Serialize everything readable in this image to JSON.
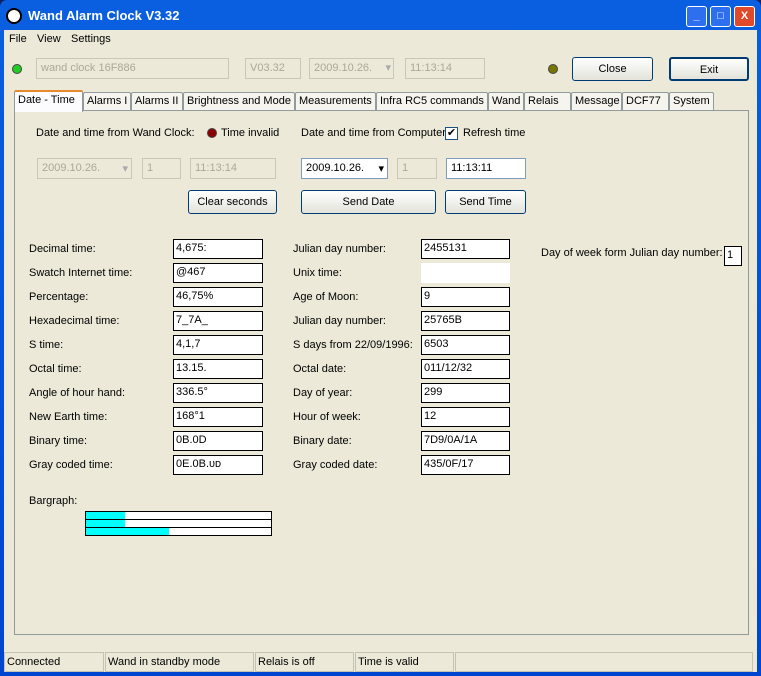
{
  "window": {
    "title": "Wand Alarm Clock V3.32",
    "minimize": "_",
    "maximize": "□",
    "close": "X"
  },
  "menu": [
    "File",
    "View",
    "Settings"
  ],
  "top": {
    "device_name": "wand clock 16F886",
    "version": "V03.32",
    "date": "2009.10.26.",
    "time": "11:13:14",
    "close_label": "Close",
    "exit_label": "Exit",
    "led_connected_color": "#22cc22",
    "led_status_color": "#777700"
  },
  "tabs": [
    "Date - Time",
    "Alarms I",
    "Alarms II",
    "Brightness and Mode",
    "Measurements",
    "Infra RC5 commands",
    "Wand",
    "Relais",
    "Message",
    "DCF77",
    "System"
  ],
  "datetime": {
    "wand_label": "Date and time from Wand Clock:",
    "time_invalid": "Time invalid",
    "computer_label": "Date and time from Computer:",
    "refresh_label": "Refresh time",
    "refresh_checked": true,
    "wand_date": "2009.10.26.",
    "wand_dow": "1",
    "wand_time": "11:13:14",
    "pc_date": "2009.10.26.",
    "pc_dow": "1",
    "pc_time": "11:13:11",
    "clear_seconds": "Clear seconds",
    "send_date": "Send Date",
    "send_time": "Send Time"
  },
  "left_fields": [
    {
      "label": "Decimal time:",
      "value": "4,675:"
    },
    {
      "label": "Swatch Internet time:",
      "value": "@467"
    },
    {
      "label": "Percentage:",
      "value": " 46,75%"
    },
    {
      "label": "Hexadecimal time:",
      "value": "7_7A_"
    },
    {
      "label": "S time:",
      "value": "4,1,7"
    },
    {
      "label": "Octal time:",
      "value": "13.15."
    },
    {
      "label": "Angle of hour hand:",
      "value": "336.5°"
    },
    {
      "label": "New Earth time:",
      "value": "168°1"
    },
    {
      "label": "Binary time:",
      "value": "0B.0D"
    },
    {
      "label": "Gray coded time:",
      "value": "0E.0B.ᴜᴅ"
    }
  ],
  "right_fields": [
    {
      "label": "Julian day number:",
      "value": "  2455131"
    },
    {
      "label": "Unix time:",
      "value": ""
    },
    {
      "label": "Age of Moon:",
      "value": "9"
    },
    {
      "label": "Julian day number:",
      "value": "25765B"
    },
    {
      "label": "S days from 22/09/1996:",
      "value": "6503"
    },
    {
      "label": "Octal date:",
      "value": "011/12/32"
    },
    {
      "label": "Day of year:",
      "value": "299"
    },
    {
      "label": "Hour of week:",
      "value": "12"
    },
    {
      "label": "Binary date:",
      "value": " 7D9/0A/1A"
    },
    {
      "label": "Gray coded date:",
      "value": " 435/0F/17"
    }
  ],
  "dow": {
    "label": "Day of week form Julian day number:",
    "value": "1"
  },
  "bargraph": {
    "label": "Bargraph:",
    "levels_percent": [
      21,
      21,
      45
    ],
    "color": "#00ffff"
  },
  "statusbar": [
    "Connected",
    "Wand in standby mode",
    "Relais is off",
    "Time is valid",
    ""
  ]
}
